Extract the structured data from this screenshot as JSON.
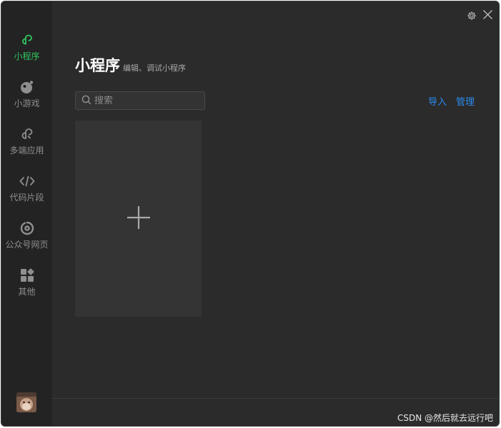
{
  "sidebar": {
    "items": [
      {
        "label": "小程序",
        "icon": "miniprogram-icon",
        "active": true
      },
      {
        "label": "小游戏",
        "icon": "minigame-icon",
        "active": false
      },
      {
        "label": "多端应用",
        "icon": "multi-platform-icon",
        "active": false
      },
      {
        "label": "代码片段",
        "icon": "code-icon",
        "active": false
      },
      {
        "label": "公众号网页",
        "icon": "webpage-icon",
        "active": false
      },
      {
        "label": "其他",
        "icon": "grid-icon",
        "active": false
      }
    ],
    "active_color": "#2fc55f"
  },
  "header": {
    "title": "小程序",
    "subtitle": "编辑、调试小程序"
  },
  "search": {
    "placeholder": "搜索"
  },
  "actions": {
    "import_label": "导入",
    "manage_label": "管理",
    "link_color": "#2b8cf0"
  },
  "watermark": "CSDN @然后就去远行吧"
}
